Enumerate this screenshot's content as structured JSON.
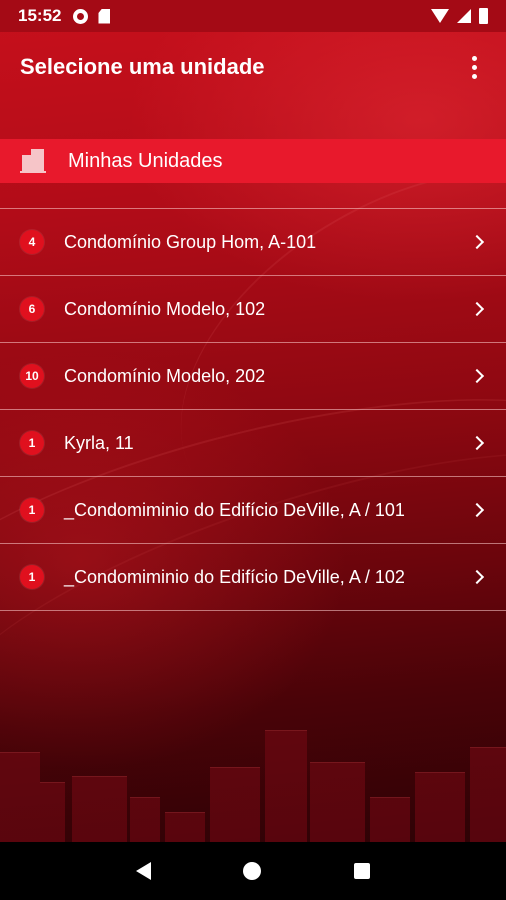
{
  "status_bar": {
    "time": "15:52",
    "icons": [
      "settings-icon",
      "sim-card-icon",
      "wifi-icon",
      "signal-icon",
      "battery-icon"
    ]
  },
  "app_bar": {
    "title": "Selecione uma unidade",
    "menu_icon": "more-vert-icon"
  },
  "section": {
    "icon": "building-icon",
    "label": "Minhas Unidades"
  },
  "units": [
    {
      "badge": "4",
      "label": "Condomínio Group Hom, A-101"
    },
    {
      "badge": "6",
      "label": "Condomínio Modelo, 102"
    },
    {
      "badge": "10",
      "label": "Condomínio Modelo, 202"
    },
    {
      "badge": "1",
      "label": "Kyrla, 11"
    },
    {
      "badge": "1",
      "label": "_Condomiminio do Edifício DeVille, A / 101"
    },
    {
      "badge": "1",
      "label": "_Condomiminio do Edifício DeVille, A / 102"
    }
  ],
  "nav_bar": {
    "icons": [
      "back-icon",
      "home-icon",
      "recents-icon"
    ]
  },
  "colors": {
    "accent": "#e8192c",
    "badge": "#e0101e",
    "status_bar": "#a40a15"
  }
}
